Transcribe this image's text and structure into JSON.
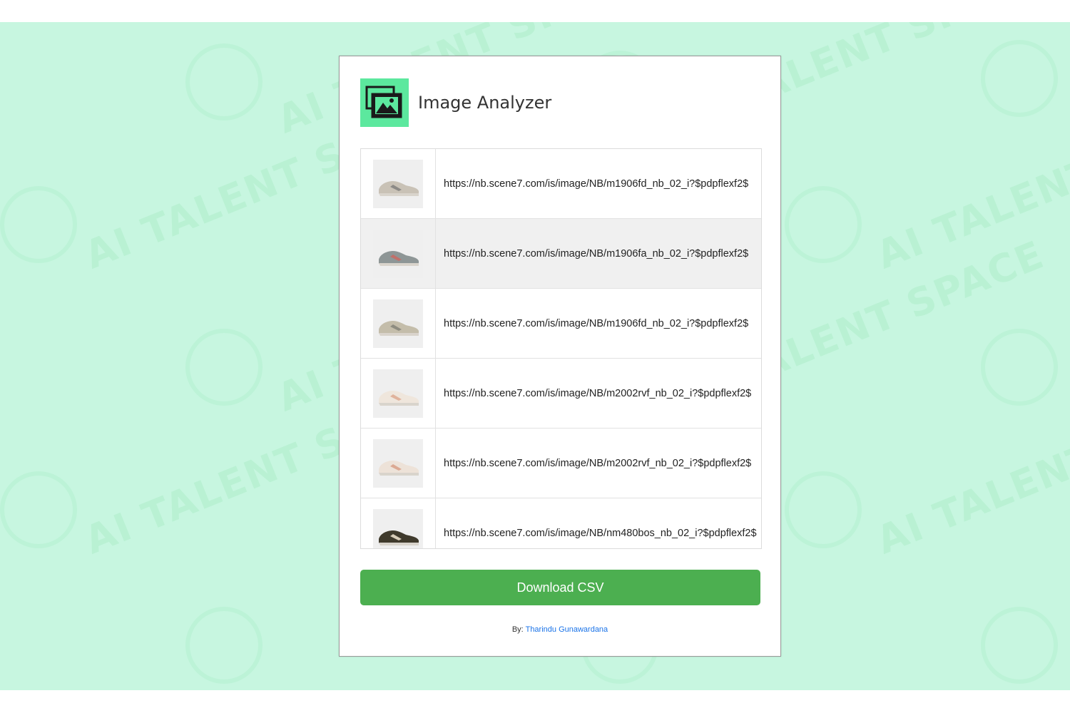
{
  "app": {
    "title": "Image Analyzer",
    "icon": "image-gallery-icon",
    "accent_color": "#5ce89e"
  },
  "images": [
    {
      "url": "https://nb.scene7.com/is/image/NB/m1906fd_nb_02_i?$pdpflexf2$",
      "thumb": "shoe-beige",
      "thumb_colors": [
        "#c9c2b6",
        "#8c8a86"
      ]
    },
    {
      "url": "https://nb.scene7.com/is/image/NB/m1906fa_nb_02_i?$pdpflexf2$",
      "thumb": "shoe-grey",
      "thumb_colors": [
        "#8e9696",
        "#c0706a"
      ]
    },
    {
      "url": "https://nb.scene7.com/is/image/NB/m1906fd_nb_02_i?$pdpflexf2$",
      "thumb": "shoe-beige",
      "thumb_colors": [
        "#c4bdaa",
        "#8e8c80"
      ]
    },
    {
      "url": "https://nb.scene7.com/is/image/NB/m2002rvf_nb_02_i?$pdpflexf2$",
      "thumb": "shoe-cream",
      "thumb_colors": [
        "#efe6dc",
        "#e0b39c"
      ]
    },
    {
      "url": "https://nb.scene7.com/is/image/NB/m2002rvf_nb_02_i?$pdpflexf2$",
      "thumb": "shoe-cream",
      "thumb_colors": [
        "#ede2d8",
        "#dba993"
      ]
    },
    {
      "url": "https://nb.scene7.com/is/image/NB/nm480bos_nb_02_i?$pdpflexf2$",
      "thumb": "shoe-dark",
      "thumb_colors": [
        "#3f3a2c",
        "#d8cdb8"
      ]
    }
  ],
  "actions": {
    "download_label": "Download CSV",
    "download_color": "#4caf50"
  },
  "footer": {
    "by_label": "By:",
    "author": "Tharindu Gunawardana",
    "author_color": "#1a73e8"
  },
  "watermark": {
    "text": "AI TALENT SPACE",
    "color": "#96e6b4"
  }
}
